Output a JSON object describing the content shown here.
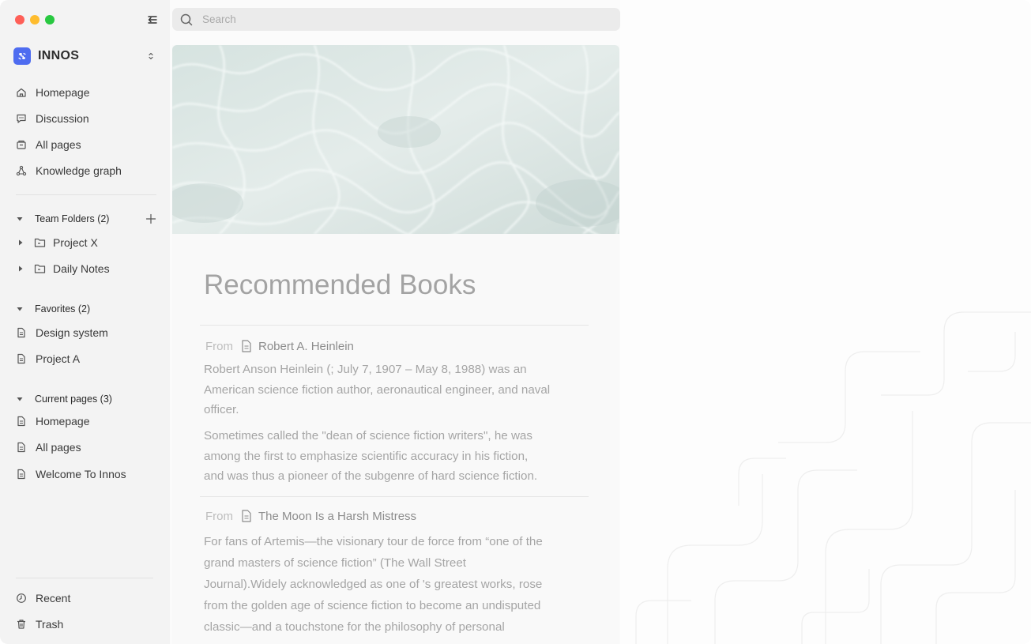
{
  "workspace": {
    "name": "INNOS"
  },
  "nav": [
    {
      "label": "Homepage",
      "icon": "home-icon"
    },
    {
      "label": "Discussion",
      "icon": "chat-icon"
    },
    {
      "label": "All pages",
      "icon": "pages-icon"
    },
    {
      "label": "Knowledge graph",
      "icon": "graph-icon"
    }
  ],
  "team_folders": {
    "label": "Team Folders (2)",
    "items": [
      {
        "label": "Project X"
      },
      {
        "label": "Daily Notes"
      }
    ]
  },
  "favorites": {
    "label": "Favorites (2)",
    "items": [
      {
        "label": "Design system"
      },
      {
        "label": "Project A"
      }
    ]
  },
  "current_pages": {
    "label": "Current pages (3)",
    "items": [
      {
        "label": "Homepage"
      },
      {
        "label": "All pages"
      },
      {
        "label": "Welcome To Innos"
      }
    ]
  },
  "bottom": [
    {
      "label": "Recent",
      "icon": "clock-icon"
    },
    {
      "label": "Trash",
      "icon": "trash-icon"
    }
  ],
  "search": {
    "placeholder": "Search"
  },
  "page": {
    "title": "Recommended Books",
    "references": [
      {
        "from": "From",
        "source": "Robert A. Heinlein",
        "lines": [
          "Robert Anson Heinlein (; July 7, 1907 – May 8, 1988) was an",
          "American science fiction author, aeronautical engineer, and naval",
          "officer.",
          "Sometimes called the \"dean of science fiction writers\", he was",
          "among the first to emphasize scientific accuracy in his fiction,",
          "and was thus a pioneer of the subgenre of hard science fiction."
        ]
      },
      {
        "from": "From",
        "source": "The Moon Is a Harsh Mistress",
        "lines": [
          "For fans of Artemis—the visionary tour de force from “one of the",
          "grand masters of science fiction” (The Wall Street",
          "Journal).Widely acknowledged as one of  's greatest works,  rose",
          "from the golden age of science fiction to become an undisputed",
          "classic—and a touchstone for the philosophy of personal"
        ]
      }
    ]
  },
  "colors": {
    "accent": "#4e6cf0",
    "sidebar_bg": "#f3f3f3"
  }
}
